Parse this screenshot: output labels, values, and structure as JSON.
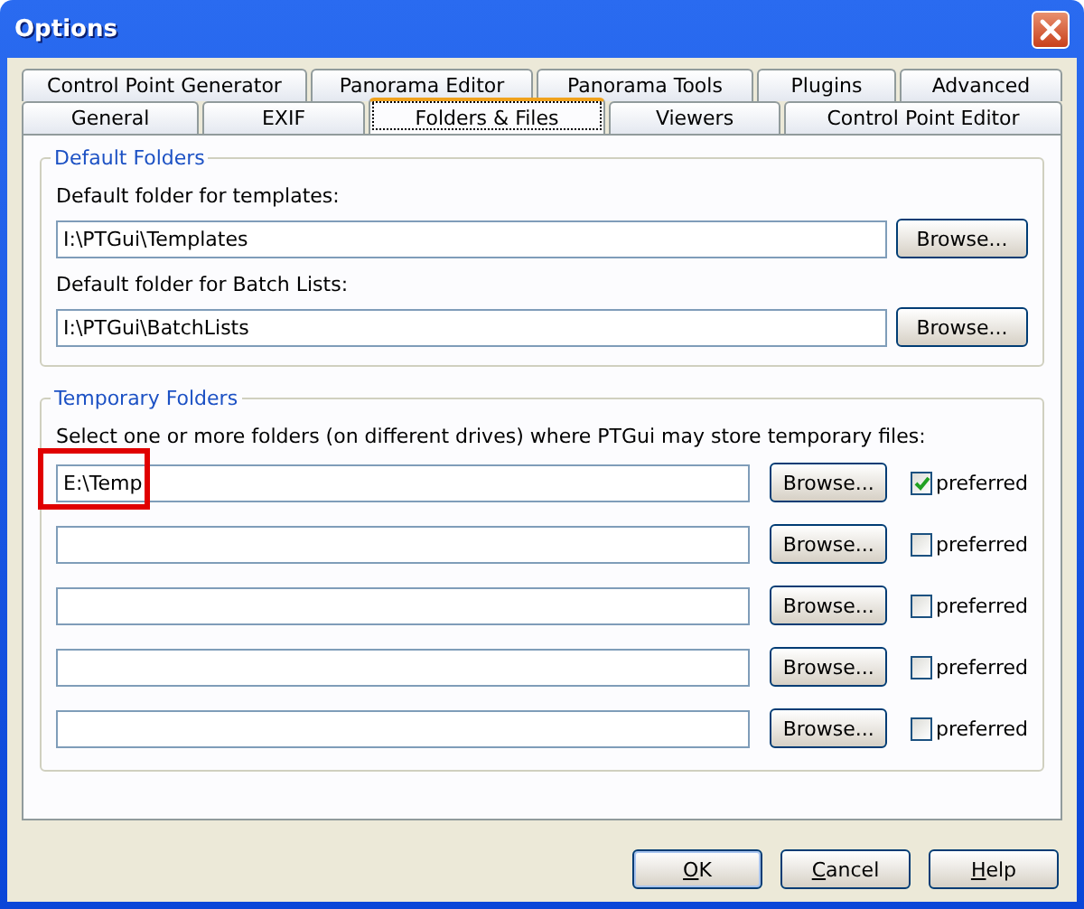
{
  "window": {
    "title": "Options"
  },
  "tab_rows": [
    [
      {
        "label": "Control Point Generator",
        "selected": false
      },
      {
        "label": "Panorama Editor",
        "selected": false
      },
      {
        "label": "Panorama Tools",
        "selected": false
      },
      {
        "label": "Plugins",
        "selected": false
      },
      {
        "label": "Advanced",
        "selected": false
      }
    ],
    [
      {
        "label": "General",
        "selected": false
      },
      {
        "label": "EXIF",
        "selected": false
      },
      {
        "label": "Folders & Files",
        "selected": true
      },
      {
        "label": "Viewers",
        "selected": false
      },
      {
        "label": "Control Point Editor",
        "selected": false
      }
    ]
  ],
  "default_folders": {
    "title": "Default Folders",
    "fields": [
      {
        "label": "Default folder for templates:",
        "value": "I:\\PTGui\\Templates",
        "button": "Browse..."
      },
      {
        "label": "Default folder for Batch Lists:",
        "value": "I:\\PTGui\\BatchLists",
        "button": "Browse..."
      }
    ]
  },
  "temporary_folders": {
    "title": "Temporary Folders",
    "description": "Select one or more folders (on different drives) where PTGui may store temporary files:",
    "rows": [
      {
        "value": "E:\\Temp",
        "highlighted": true,
        "button": "Browse...",
        "checkbox": "preferred",
        "checked": true
      },
      {
        "highlighted": false,
        "button": "Browse...",
        "checkbox": "preferred",
        "checked": false
      },
      {
        "highlighted": false,
        "button": "Browse...",
        "checkbox": "preferred",
        "checked": false
      },
      {
        "highlighted": false,
        "button": "Browse...",
        "checkbox": "preferred",
        "checked": false
      },
      {
        "highlighted": false,
        "button": "Browse...",
        "checkbox": "preferred",
        "checked": false
      }
    ]
  },
  "buttons": [
    {
      "label": "OK",
      "mnemonic": true,
      "default": true
    },
    {
      "label": "Cancel",
      "mnemonic": true,
      "default": false
    },
    {
      "label": "Help",
      "mnemonic": true,
      "default": false
    }
  ]
}
